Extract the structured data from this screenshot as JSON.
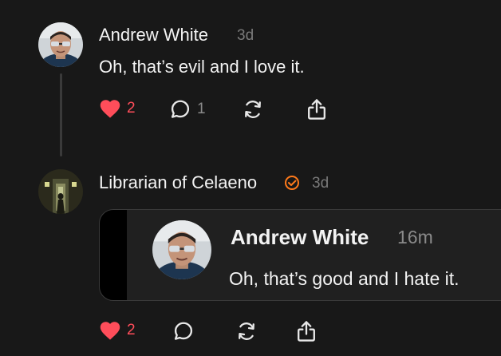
{
  "post1": {
    "author": "Andrew White",
    "time": "3d",
    "text": "Oh, that’s evil and I love it.",
    "likes": "2",
    "replies": "1"
  },
  "post2": {
    "author": "Librarian of Celaeno",
    "time": "3d",
    "likes": "2",
    "quote": {
      "author": "Andrew White",
      "time": "16m",
      "text": "Oh, that’s good and I hate it."
    }
  },
  "icons": {
    "like": "heart-icon",
    "reply": "comment-icon",
    "repost": "repost-icon",
    "share": "share-icon",
    "verified": "verified-badge-icon"
  },
  "colors": {
    "background": "#181818",
    "like": "#ff4d5a",
    "verified": "#ff7a1a",
    "muted": "#7a7a7a"
  }
}
